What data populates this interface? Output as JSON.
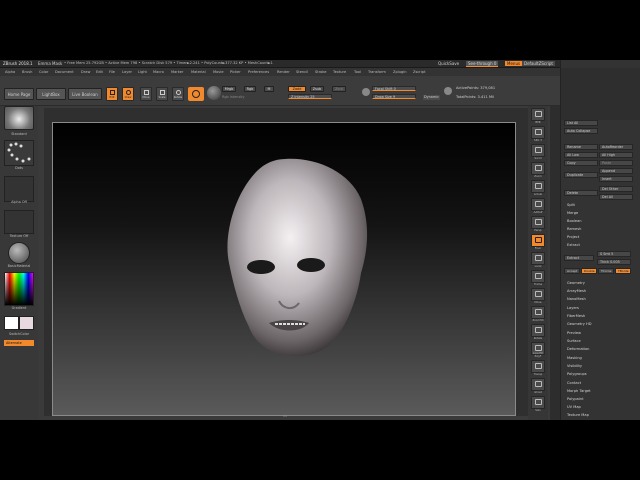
{
  "title_bar": {
    "app": "ZBrush 2018.1",
    "doc": "Emma Mask",
    "stats": "• Free Mem 25.792GB • Active Mem 798 • Scratch Disk 579 • Timer►2.241 • PolyCount►377.32 KP • MeshCount►1",
    "quicksave": "QuickSave",
    "seethrough": "See-through 0",
    "menus": "Menus",
    "script": "DefaultZScript"
  },
  "menu": [
    "Alpha",
    "Brush",
    "Color",
    "Document",
    "Draw",
    "Edit",
    "File",
    "Layer",
    "Light",
    "Macro",
    "Marker",
    "Material",
    "Movie",
    "Picker",
    "Preferences",
    "Render",
    "Stencil",
    "Stroke",
    "Texture",
    "Tool",
    "Transform",
    "Zplugin",
    "Zscript"
  ],
  "shelf": {
    "home_page": "Home Page",
    "lightbox": "LightBox",
    "live_boolean": "Live Boolean",
    "tools": [
      "Edit",
      "Draw",
      "Move",
      "Scale",
      "Rotate"
    ],
    "mrgb": "Mrgb",
    "rgb": "Rgb",
    "m": "M",
    "rgb_intensity": "Rgb Intensity",
    "zadd": "Zadd",
    "zsub": "Zsub",
    "zcut": "Zcut",
    "z_intensity": "Z Intensity 25",
    "focal_shift": "Focal Shift 0",
    "draw_size": "Draw Size 9",
    "dynamic": "Dynamic",
    "active_points": "ActivePoints: 379,081",
    "total_points": "TotalPoints: 3.411 Mil"
  },
  "left_tray": {
    "brush": "Standard",
    "stroke": "Dots",
    "alpha": "Alpha Off",
    "texture": "Texture Off",
    "material": "BasicMaterial",
    "gradient": "Gradient",
    "switch_color": "SwitchColor",
    "alternate": "Alternate",
    "colors": {
      "main": "#ffffff",
      "secondary": "#e8d8e0",
      "accent": "#f28a2d"
    }
  },
  "right_strip": [
    "BPR",
    "SPix 3",
    "Scroll",
    "Zoom",
    "Actual",
    "AAHalf",
    "Persp",
    "Floor",
    "Local",
    "Frame",
    "Move",
    "Zoom3D",
    "Rotate",
    "Line Fill PolyF",
    "Transp",
    "Ghost",
    "Solo",
    "Xpose",
    "Dynamic"
  ],
  "subtool_panel": {
    "list_all": "List All",
    "auto_collapse": "Auto Collapse",
    "rename": "Rename",
    "autoreorder": "AutoReorder",
    "all_low": "All Low",
    "all_high": "All High",
    "copy": "Copy",
    "paste": "Paste",
    "duplicate": "Duplicate",
    "append": "Append",
    "insert": "Insert",
    "delete": "Delete",
    "del_other": "Del Other",
    "del_all": "Del All",
    "items": [
      "Split",
      "Merge",
      "Boolean",
      "Remesh",
      "Project",
      "Extract"
    ],
    "extract": "Extract",
    "smooth": "S Smt 5",
    "thick": "Thick 0.005",
    "accept": "Accept",
    "double": "Double",
    "tcorne": "TCorne",
    "tborder": "TBorde",
    "sections": [
      "Geometry",
      "ArrayMesh",
      "NanoMesh",
      "Layers",
      "FiberMesh",
      "Geometry HD",
      "Preview",
      "Surface",
      "Deformation",
      "Masking",
      "Visibility",
      "Polygroups",
      "Contact",
      "Morph Target",
      "Polypaint",
      "UV Map",
      "Texture Map"
    ]
  },
  "canvas": {
    "bottom_marker": "15"
  }
}
